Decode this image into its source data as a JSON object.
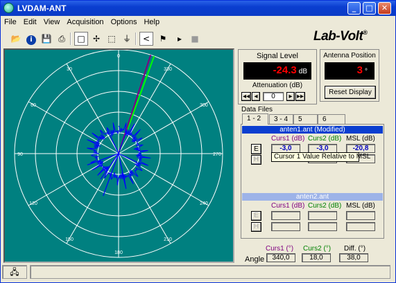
{
  "window": {
    "title": "LVDAM-ANT"
  },
  "menu": [
    "File",
    "Edit",
    "View",
    "Acquisition",
    "Options",
    "Help"
  ],
  "logo": {
    "text": "Lab-Volt",
    "mark": "®"
  },
  "polar": {
    "angle_labels": [
      "0",
      "30",
      "60",
      "90",
      "120",
      "150",
      "180",
      "210",
      "240",
      "270",
      "300",
      "330"
    ]
  },
  "signal": {
    "heading": "Signal Level",
    "value": "-24.3",
    "unit": "dB"
  },
  "attenuation": {
    "label": "Attenuation (dB)",
    "value": "0"
  },
  "antenna": {
    "heading": "Antenna Position",
    "value": "3",
    "unit": "°",
    "reset_label": "Reset Display"
  },
  "datafiles": {
    "label": "Data Files",
    "tabs": [
      "1 - 2",
      "3 - 4",
      "5",
      "6"
    ],
    "file1": {
      "name": "anten1.ant (Modified)",
      "curs1_header": "Curs1 (dB)",
      "curs2_header": "Curs2 (dB)",
      "msl_header": "MSL (dB)",
      "e_label": "E",
      "h_label": "H",
      "curs1_value": "-3,0",
      "curs2_value": "-3,0",
      "msl_value": "-20,8",
      "tooltip": "Cursor 1 Value Relative to MSL"
    },
    "file2": {
      "name": "anten2.ant",
      "curs1_header": "Curs1 (dB)",
      "curs2_header": "Curs2 (dB)",
      "msl_header": "MSL (dB)",
      "e_label": "E",
      "h_label": "H"
    }
  },
  "angle": {
    "label": "Angle",
    "curs1_header": "Curs1 (°)",
    "curs2_header": "Curs2 (°)",
    "diff_header": "Diff. (°)",
    "curs1_value": "340,0",
    "curs2_value": "18,0",
    "diff_value": "38,0"
  },
  "colors": {
    "plot_bg": "#008080",
    "trace": "#0000ff",
    "cursor1": "#00ff00",
    "cursor2": "#800080",
    "lcd_value": "#ff0000"
  }
}
